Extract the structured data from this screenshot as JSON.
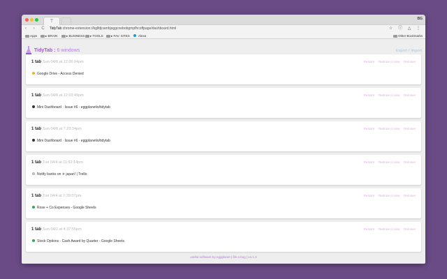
{
  "browser": {
    "tab_label": "T",
    "profile": "BG",
    "nav_icons": "‹ › C ⌂",
    "url_site": "TidyTab",
    "url_path": "chrome-extension://kglfdjcamhjoggcnebobgmpfhcoffpage/dashboard.html",
    "ext_icons": "☆ ⓘ △ ⋮",
    "bookmarks": [
      {
        "label": "Apps"
      },
      {
        "label": "▸ BRAIN"
      },
      {
        "label": "▸ BUSINESS"
      },
      {
        "label": "▸ TOOLS"
      },
      {
        "label": "▸ FAV. SITES"
      },
      {
        "label": "Alexa"
      }
    ],
    "other_bookmarks": "Other Bookmarks"
  },
  "app": {
    "title": "TidyTab",
    "separator": " : ",
    "window_count": "6 windows",
    "export_label": "Export",
    "divider": "/",
    "import_label": "Import"
  },
  "actions": {
    "restore": "Restore",
    "restore_new": "Restore in new",
    "remove": "Remove"
  },
  "groups": [
    {
      "count": "1 tab",
      "time": "Sun 04/8 at 12:06:04pm",
      "item": "Google Drive - Access Denied",
      "icon": "drive"
    },
    {
      "count": "1 tab",
      "time": "Sun 04/8 at 12:03:49pm",
      "item": "Mini Dashboard · Issue #6 · eggplanetio/tidytab",
      "icon": "github"
    },
    {
      "count": "1 tab",
      "time": "Sun 04/8 at 7:29:34pm",
      "item": "Mini Dashboard · Issue #6 · eggplanetio/tidytab",
      "icon": "github"
    },
    {
      "count": "1 tab",
      "time": "Tue 04/4 at 11:52:14pm",
      "item": "Notify banks on ✈ japan! | Trello",
      "icon": "trello"
    },
    {
      "count": "1 tab",
      "time": "Tue 04/4 at 7:39:07pm",
      "item": "Rose + Co Expenses - Google Sheets",
      "icon": "sheets"
    },
    {
      "count": "1 tab",
      "time": "Sun 04/2 at 4:37:55pm",
      "item": "Stock Options - Cash Award by Quarter - Google Sheets",
      "icon": "sheets"
    }
  ],
  "footer": "useful software by eggplanet | file a bug | v4.1.3"
}
